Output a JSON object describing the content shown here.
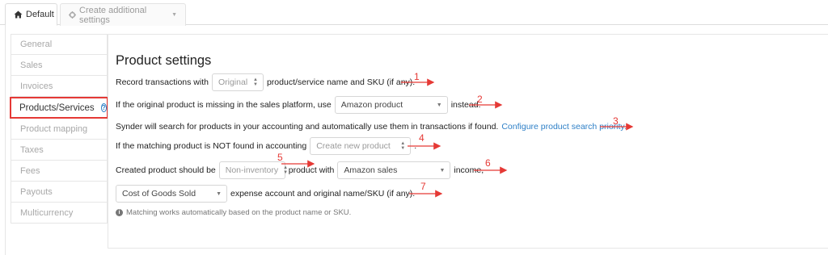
{
  "tabs": {
    "default_label": "Default",
    "create_label": "Create additional settings"
  },
  "sidebar": {
    "items": [
      {
        "label": "General"
      },
      {
        "label": "Sales"
      },
      {
        "label": "Invoices"
      },
      {
        "label": "Products/Services"
      },
      {
        "label": "Product mapping"
      },
      {
        "label": "Taxes"
      },
      {
        "label": "Fees"
      },
      {
        "label": "Payouts"
      },
      {
        "label": "Multicurrency"
      }
    ]
  },
  "main": {
    "title": "Product settings",
    "row1": {
      "prefix": "Record transactions with",
      "select": "Original",
      "suffix": "product/service name and SKU (if any)."
    },
    "row2": {
      "prefix": "If the original product is missing in the sales platform, use",
      "select": "Amazon product",
      "suffix": "instead."
    },
    "row3": {
      "text": "Synder will search for products in your accounting and automatically use them in transactions if found.",
      "link": "Configure product search priority."
    },
    "row4": {
      "prefix": "If the matching product is NOT found in accounting",
      "select": "Create new product",
      "suffix": "."
    },
    "row5": {
      "prefix": "Created product should be",
      "select1": "Non-inventory",
      "middle": "product with",
      "select2": "Amazon sales",
      "suffix": "income,"
    },
    "row6": {
      "select": "Cost of Goods Sold",
      "suffix": "expense account and original name/SKU (if any)."
    },
    "note": "Matching works automatically based on the product name or SKU."
  },
  "annotations": [
    "1",
    "2",
    "3",
    "4",
    "5",
    "6",
    "7"
  ],
  "colors": {
    "accent": "#2f80c7",
    "annotation": "#e53935"
  }
}
